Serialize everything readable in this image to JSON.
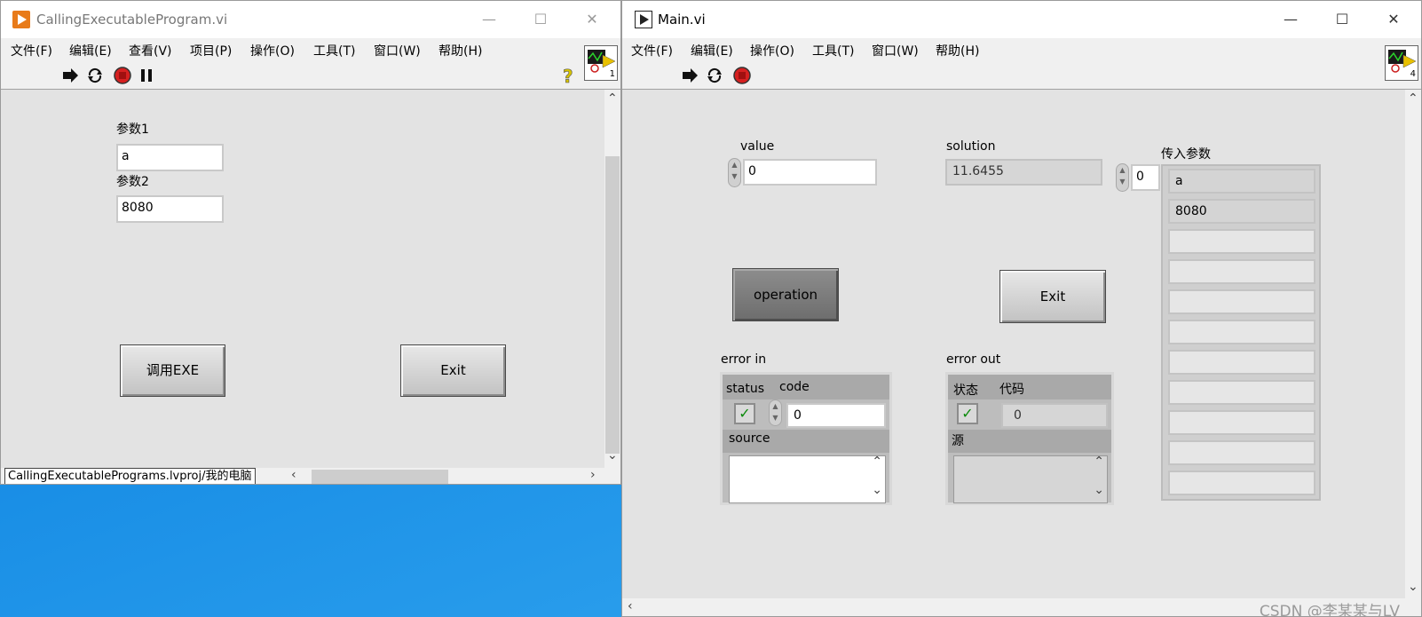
{
  "left_window": {
    "title": "CallingExecutableProgram.vi",
    "controls": {
      "minimize": "—",
      "maximize": "☐",
      "close": "✕"
    },
    "menu": [
      "文件(F)",
      "编辑(E)",
      "查看(V)",
      "项目(P)",
      "操作(O)",
      "工具(T)",
      "窗口(W)",
      "帮助(H)"
    ],
    "toolbar_icons": [
      "run-arrow-icon",
      "run-continuously-icon",
      "abort-icon",
      "pause-icon",
      "help-icon"
    ],
    "vi_icon_number": "1",
    "param1_label": "参数1",
    "param1_value": "a",
    "param2_label": "参数2",
    "param2_value": "8080",
    "call_button": "调用EXE",
    "exit_button": "Exit",
    "status_path": "CallingExecutablePrograms.lvproj/我的电脑"
  },
  "right_window": {
    "title": "Main.vi",
    "controls": {
      "minimize": "—",
      "maximize": "☐",
      "close": "✕"
    },
    "menu": [
      "文件(F)",
      "编辑(E)",
      "操作(O)",
      "工具(T)",
      "窗口(W)",
      "帮助(H)"
    ],
    "toolbar_icons": [
      "run-arrow-icon",
      "run-continuously-icon",
      "abort-icon"
    ],
    "vi_icon_number": "4",
    "value_label": "value",
    "value_value": "0",
    "solution_label": "solution",
    "solution_value": "11.6455",
    "array_index": "0",
    "array_label": "传入参数",
    "array_values": [
      "a",
      "8080",
      "",
      "",
      "",
      "",
      "",
      "",
      "",
      "",
      ""
    ],
    "operation_button": "operation",
    "exit_button": "Exit",
    "error_in": {
      "label": "error in",
      "status_label": "status",
      "code_label": "code",
      "code_value": "0",
      "source_label": "source"
    },
    "error_out": {
      "label": "error out",
      "status_label": "状态",
      "code_label": "代码",
      "code_value": "0",
      "source_label": "源"
    },
    "watermark": "CSDN @李某某与LV"
  },
  "colors": {
    "desktop": "#1a8fe6",
    "panel": "#e3e3e3",
    "check_green": "#0b8a0b",
    "labview_orange": "#e87b1a"
  }
}
